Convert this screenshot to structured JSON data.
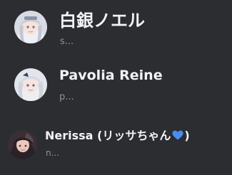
{
  "members": [
    {
      "name": "白銀ノエル",
      "status": "s..."
    },
    {
      "name": "Pavolia Reine",
      "status": "p..."
    },
    {
      "name_prefix": "Nerissa (リッサちゃん",
      "name_suffix": ")",
      "status": "n..."
    }
  ],
  "colors": {
    "background": "#2b2d31",
    "name_text": "#f2f3f5",
    "status_text": "#8e9297",
    "heart": "#4a8cf0"
  },
  "icons": [
    "blue-heart-icon"
  ]
}
